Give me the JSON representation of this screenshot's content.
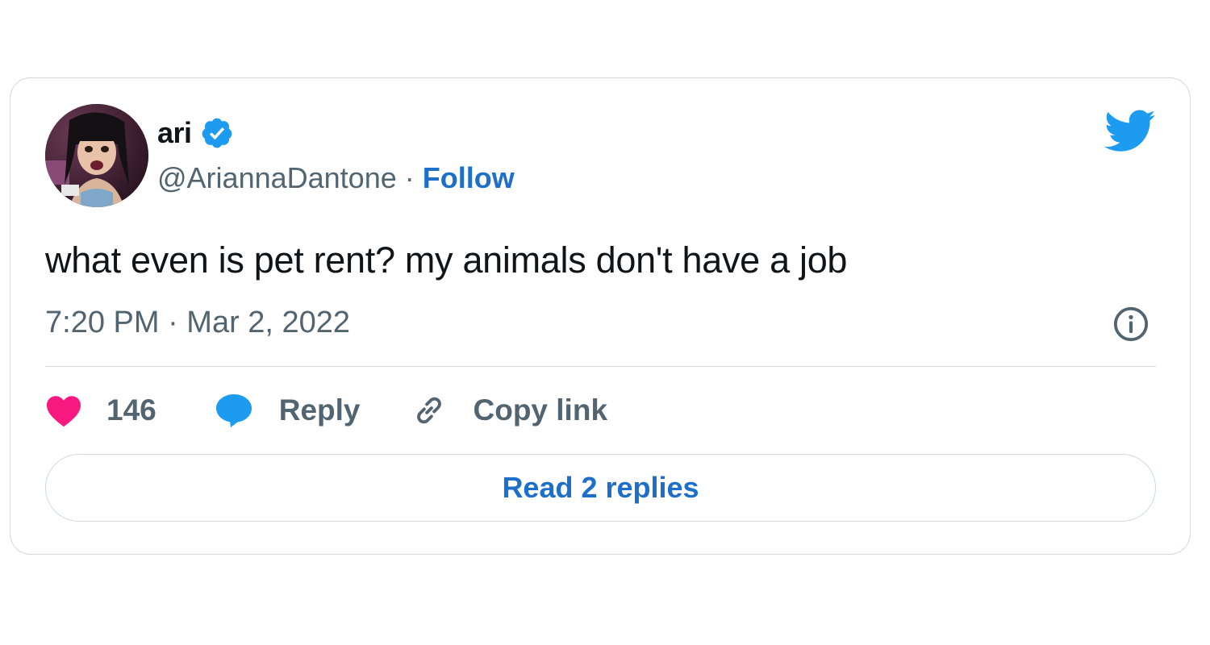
{
  "author": {
    "display_name": "ari",
    "handle": "@AriannaDantone",
    "separator": "·",
    "follow_label": "Follow",
    "verified": true,
    "avatar_icon": "avatar-photo"
  },
  "tweet": {
    "text": "what even is pet rent? my animals don't have a job",
    "timestamp": "7:20 PM · Mar 2, 2022"
  },
  "actions": {
    "like_count": "146",
    "reply_label": "Reply",
    "copy_label": "Copy link"
  },
  "read_replies_label": "Read 2 replies",
  "icons": {
    "like": "heart-icon",
    "reply": "speech-bubble-icon",
    "copy": "link-icon",
    "info": "info-icon",
    "brand": "twitter-bird-icon",
    "verified": "verified-badge-icon"
  },
  "colors": {
    "brand_blue": "#1d9bf0",
    "link_blue": "#1d6fc9",
    "like_pink": "#f91880",
    "secondary_text": "#536471",
    "primary_text": "#0f1419",
    "border": "#cfd9de"
  }
}
